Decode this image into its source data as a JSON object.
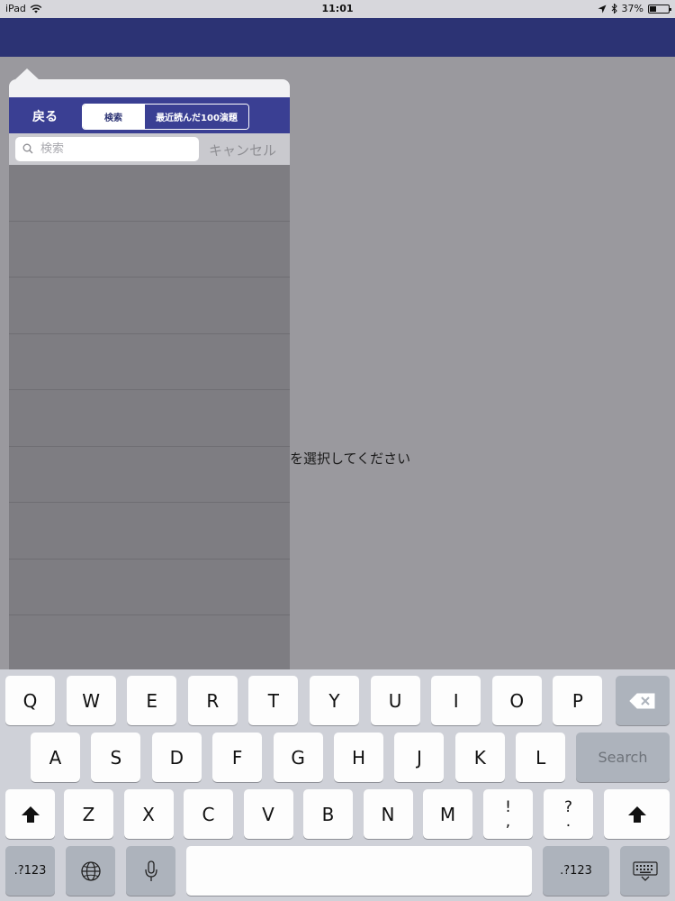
{
  "status_bar": {
    "device": "iPad",
    "time": "11:01",
    "battery_percent": "37%",
    "battery_level": 0.37
  },
  "popover": {
    "back_label": "戻る",
    "segments": [
      {
        "label": "検索",
        "selected": true
      },
      {
        "label": "最近読んだ100演題",
        "selected": false
      }
    ],
    "search": {
      "placeholder": "検索",
      "value": "",
      "cancel_label": "キャンセル"
    },
    "result_rows": 9
  },
  "main": {
    "placeholder_text": "を選択してください"
  },
  "keyboard": {
    "row1": [
      "Q",
      "W",
      "E",
      "R",
      "T",
      "Y",
      "U",
      "I",
      "O",
      "P"
    ],
    "row2": [
      "A",
      "S",
      "D",
      "F",
      "G",
      "H",
      "J",
      "K",
      "L"
    ],
    "row3": [
      "Z",
      "X",
      "C",
      "V",
      "B",
      "N",
      "M"
    ],
    "punct1": [
      "!",
      ","
    ],
    "punct2": [
      "?",
      "."
    ],
    "search_label": "Search",
    "numbers_label": ".?123"
  },
  "icons": {
    "wifi": "wifi-icon",
    "location": "location-arrow-icon",
    "bluetooth": "bluetooth-icon",
    "battery": "battery-icon",
    "search": "search-icon",
    "backspace": "backspace-icon",
    "shift": "shift-icon",
    "globe": "globe-icon",
    "microphone": "microphone-icon",
    "dismiss_keyboard": "dismiss-keyboard-icon"
  }
}
